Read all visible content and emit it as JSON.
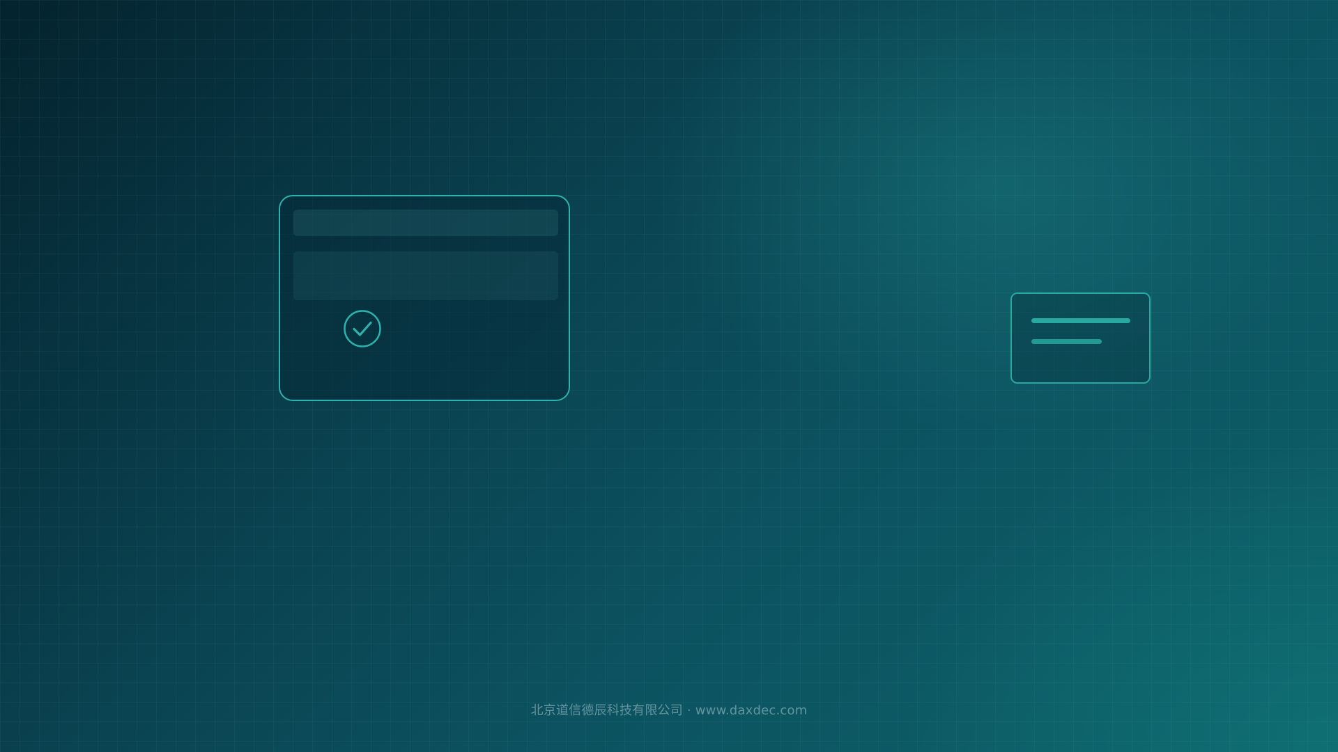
{
  "icons": {
    "status": "check-circle-icon"
  },
  "colors": {
    "accent": "#2db3ac",
    "accent_dim": "#229a93",
    "background_dark": "#04232e",
    "background_light": "#0d6168"
  },
  "footer": {
    "text": "北京道信德辰科技有限公司 · www.daxdec.com"
  }
}
